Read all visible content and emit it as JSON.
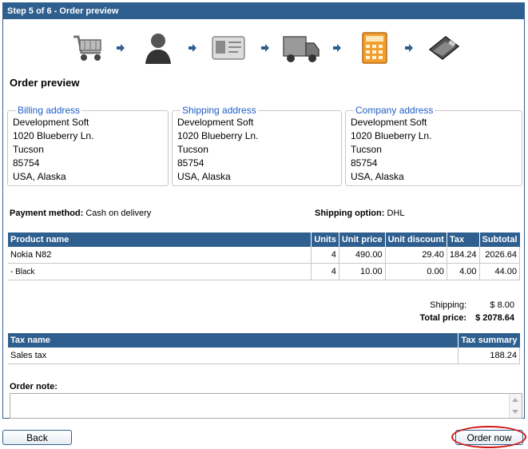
{
  "header": {
    "title": "Step 5 of 6 - Order preview"
  },
  "steps": [
    "shopping-cart-icon",
    "customer-icon",
    "id-card-icon",
    "delivery-truck-icon",
    "calculator-icon",
    "payment-wallet-icon"
  ],
  "page_title": "Order preview",
  "addresses": {
    "billing": {
      "legend": "Billing address",
      "lines": [
        "Development Soft",
        "1020 Blueberry Ln.",
        "Tucson",
        "85754",
        "USA, Alaska"
      ]
    },
    "shipping": {
      "legend": "Shipping address",
      "lines": [
        "Development Soft",
        "1020 Blueberry Ln.",
        "Tucson",
        "85754",
        "USA, Alaska"
      ]
    },
    "company": {
      "legend": "Company address",
      "lines": [
        "Development Soft",
        "1020 Blueberry Ln.",
        "Tucson",
        "85754",
        "USA, Alaska"
      ]
    }
  },
  "payment": {
    "label": "Payment method:",
    "value": "Cash on delivery"
  },
  "shipping_option": {
    "label": "Shipping option:",
    "value": "DHL"
  },
  "products": {
    "headers": [
      "Product name",
      "Units",
      "Unit price",
      "Unit discount",
      "Tax",
      "Subtotal"
    ],
    "rows": [
      [
        "Nokia N82",
        "4",
        "490.00",
        "29.40",
        "184.24",
        "2026.64"
      ],
      [
        "- Black",
        "4",
        "10.00",
        "0.00",
        "4.00",
        "44.00"
      ]
    ]
  },
  "totals": {
    "shipping_label": "Shipping:",
    "shipping_value": "$ 8.00",
    "total_label": "Total price:",
    "total_value": "$ 2078.64"
  },
  "taxes": {
    "headers": [
      "Tax name",
      "Tax summary"
    ],
    "rows": [
      [
        "Sales tax",
        "188.24"
      ]
    ]
  },
  "order_note": {
    "label": "Order note:",
    "value": ""
  },
  "buttons": {
    "back": "Back",
    "order_now": "Order now"
  },
  "colors": {
    "header_bg": "#2f5f8f",
    "legend": "#1f5fc4",
    "highlight_ring": "#d01818"
  }
}
